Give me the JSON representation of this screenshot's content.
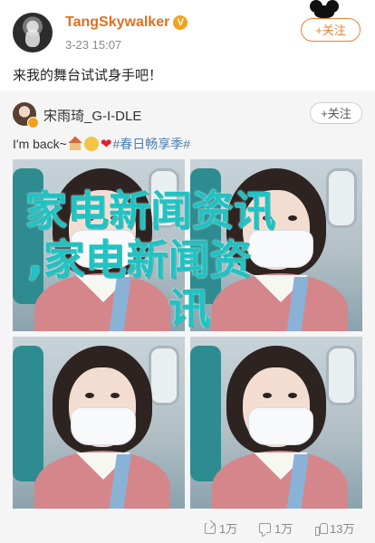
{
  "post": {
    "username": "TangSkywalker",
    "vip_badge": "V",
    "time": "3-23 15:07",
    "follow_label": "+关注",
    "text": "来我的舞台试试身手吧！"
  },
  "retweet": {
    "username": "宋雨琦_G-I-DLE",
    "follow_label": "+关注",
    "text_prefix": "I'm back~",
    "emoji_heart": "❤",
    "hashtag": "#春日畅享季#",
    "photos_count": 4,
    "actions": {
      "repost": "1万",
      "comment": "1万",
      "like": "13万"
    }
  },
  "overlay": {
    "line1": "家电新闻资讯",
    "line2": ",家电新闻资",
    "line3": "讯"
  },
  "colors": {
    "username": "#e07020",
    "follow": "#f08030",
    "hashtag": "#4a7eb4",
    "overlay": "#20c2c2",
    "retweet_bg": "#f5f5f5"
  }
}
